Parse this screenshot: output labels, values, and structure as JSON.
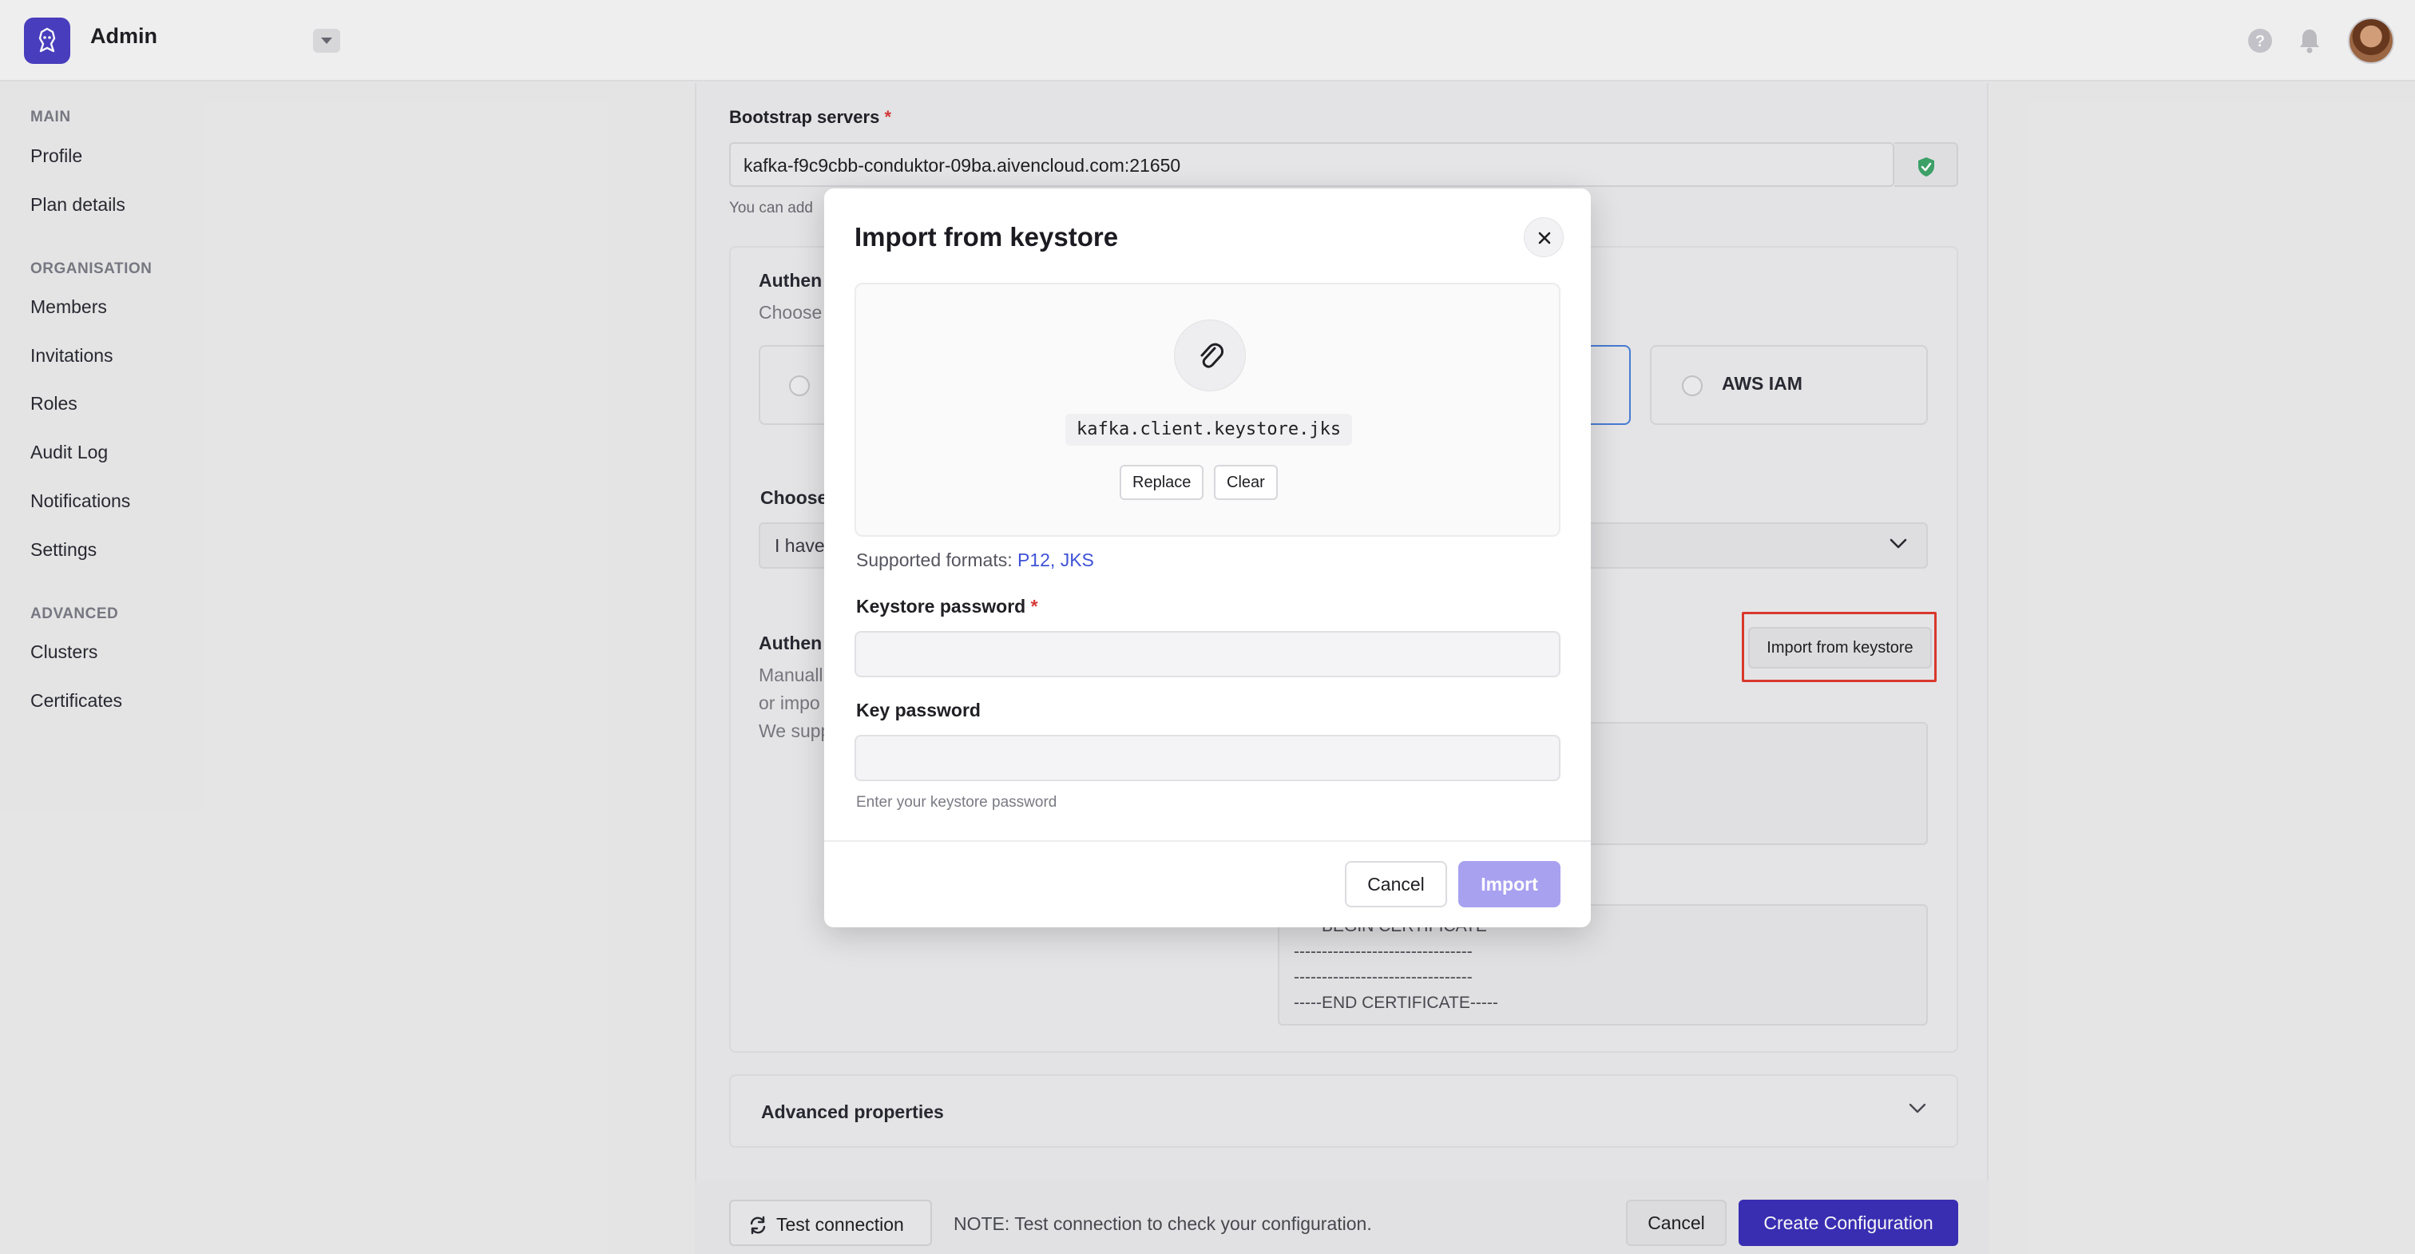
{
  "app": {
    "title": "Admin"
  },
  "sidebar": {
    "sections": [
      {
        "title": "MAIN",
        "items": [
          "Profile",
          "Plan details"
        ]
      },
      {
        "title": "ORGANISATION",
        "items": [
          "Members",
          "Invitations",
          "Roles",
          "Audit Log",
          "Notifications",
          "Settings"
        ]
      },
      {
        "title": "ADVANCED",
        "items": [
          "Clusters",
          "Certificates"
        ]
      }
    ]
  },
  "form": {
    "bootstrap_label": "Bootstrap servers",
    "required_mark": "*",
    "bootstrap_value": "kafka-f9c9cbb-conduktor-09ba.aivencloud.com:21650",
    "bootstrap_helper": "You can add",
    "auth_title_partial": "Authen",
    "auth_sub_partial": "Choose",
    "aws_iam": "AWS IAM",
    "choose_partial": "Choose",
    "select_partial": "I have",
    "auth2_partial": "Authen",
    "manual_lines": [
      "Manuall",
      "or impo",
      "We supp"
    ],
    "import_keystore_btn": "Import from keystore",
    "cert_lines": [
      "-----BEGIN CERTIFICATE-----",
      "--------------------------------",
      "--------------------------------",
      "-----END CERTIFICATE-----"
    ],
    "advanced_label": "Advanced properties"
  },
  "bottom": {
    "test_connection": "Test connection",
    "note": "NOTE: Test connection to check your configuration.",
    "cancel": "Cancel",
    "create": "Create Configuration"
  },
  "modal": {
    "title": "Import from keystore",
    "filename": "kafka.client.keystore.jks",
    "replace": "Replace",
    "clear": "Clear",
    "formats_prefix": "Supported formats:",
    "formats_links": "P12, JKS",
    "keystore_password_label": "Keystore password",
    "keystore_password_value": "",
    "key_password_label": "Key password",
    "key_password_value": "",
    "helper": "Enter your keystore password",
    "cancel": "Cancel",
    "import": "Import"
  },
  "colors": {
    "brand": "#4b3fc4",
    "primary_button": "#3b30b8",
    "import_disabled": "#a8a1f0",
    "highlight": "#e03a2f",
    "link": "#3f52d6",
    "success": "#3ea66b"
  },
  "icons": [
    "conduktor-logo-icon",
    "caret-down-icon",
    "help-icon",
    "bell-icon",
    "shield-check-icon",
    "close-icon",
    "paperclip-icon",
    "chevron-down-icon",
    "refresh-icon"
  ]
}
